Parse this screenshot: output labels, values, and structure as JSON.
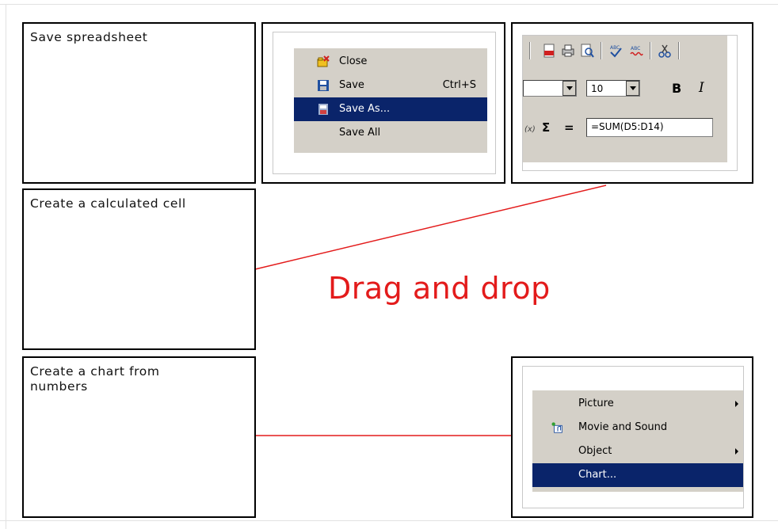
{
  "instruction": "Drag and drop",
  "terms": [
    {
      "label": "Save spreadsheet"
    },
    {
      "label": "Create a calculated cell"
    },
    {
      "label": "Create a chart from numbers"
    }
  ],
  "file_menu": {
    "items": [
      {
        "label": "Close",
        "shortcut": "",
        "icon": "folder-close-icon"
      },
      {
        "label": "Save",
        "shortcut": "Ctrl+S",
        "icon": "floppy-disk-icon"
      },
      {
        "label": "Save As...",
        "shortcut": "",
        "icon": "save-as-icon",
        "selected": true
      },
      {
        "label": "Save All",
        "shortcut": "",
        "icon": ""
      }
    ]
  },
  "formula_toolbar": {
    "font_size": "10",
    "bold_label": "B",
    "italic_label": "I",
    "sum_symbol": "Σ",
    "equals_symbol": "=",
    "formula": "=SUM(D5:D14)"
  },
  "insert_menu": {
    "items": [
      {
        "label": "Picture",
        "has_submenu": true,
        "icon": ""
      },
      {
        "label": "Movie and Sound",
        "has_submenu": false,
        "icon": "movie-sound-icon"
      },
      {
        "label": "Object",
        "has_submenu": true,
        "icon": ""
      },
      {
        "label": "Chart...",
        "has_submenu": false,
        "icon": "",
        "selected": true
      }
    ]
  },
  "colors": {
    "line": "#e31b1b",
    "menu_bg": "#d4d0c8",
    "selection": "#0a246a"
  }
}
